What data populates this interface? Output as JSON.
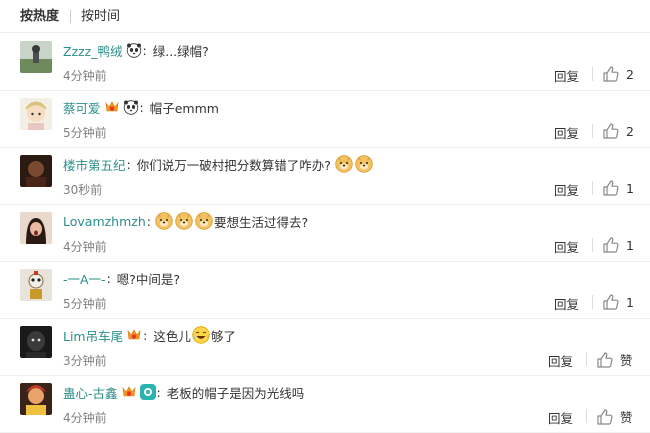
{
  "tabs": {
    "active": "按热度",
    "inactive": "按时间"
  },
  "icons": {
    "badge_panda": "panda-icon",
    "badge_vip": "vip-badge-icon",
    "thumb": "thumb-up-icon",
    "emoji_doge": "doge-emoji",
    "emoji_lol": "laugh-cry-emoji"
  },
  "colors": {
    "username": "#2b8f8b",
    "muted": "#808080"
  },
  "comments": [
    {
      "user": "Zzzz_鸭绒",
      "text": "绿...绿帽?",
      "time": "4分钟前",
      "reply": "回复",
      "likes": "2"
    },
    {
      "user": "蔡可爱",
      "text": "帽子emmm",
      "time": "5分钟前",
      "reply": "回复",
      "likes": "2"
    },
    {
      "user": "楼市第五纪",
      "text": "你们说万一破村把分数算错了咋办?",
      "time": "30秒前",
      "reply": "回复",
      "likes": "1"
    },
    {
      "user": "Lovamzhmzh",
      "text": "要想生活过得去?",
      "time": "4分钟前",
      "reply": "回复",
      "likes": "1"
    },
    {
      "user": "-一A一-",
      "text": "嗯?中间是?",
      "time": "5分钟前",
      "reply": "回复",
      "likes": "1"
    },
    {
      "user": "Lim吊车尾",
      "text_a": "这色儿",
      "text_b": "够了",
      "time": "3分钟前",
      "reply": "回复",
      "likes": "赞"
    },
    {
      "user": "蛊心-古鑫",
      "text": "老板的帽子是因为光线吗",
      "time": "4分钟前",
      "reply": "回复",
      "likes": "赞"
    }
  ]
}
